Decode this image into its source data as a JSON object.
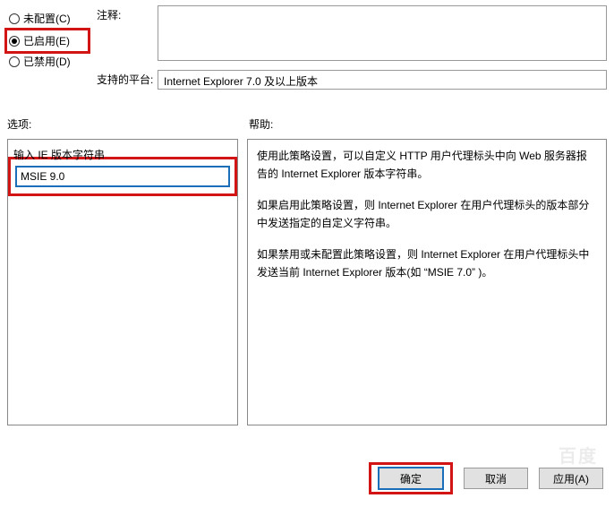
{
  "radios": {
    "unconfigured": "未配置(C)",
    "enabled": "已启用(E)",
    "disabled": "已禁用(D)"
  },
  "labels": {
    "comment": "注释:",
    "platform": "支持的平台:",
    "options": "选项:",
    "help": "帮助:",
    "ie_version": "输入 IE 版本字符串"
  },
  "values": {
    "platform_text": "Internet Explorer 7.0 及以上版本",
    "ie_input": "MSIE 9.0"
  },
  "help_text": {
    "p1": "使用此策略设置，可以自定义 HTTP 用户代理标头中向 Web 服务器报告的 Internet Explorer 版本字符串。",
    "p2": "如果启用此策略设置，则 Internet Explorer 在用户代理标头的版本部分中发送指定的自定义字符串。",
    "p3": "如果禁用或未配置此策略设置，则 Internet Explorer 在用户代理标头中发送当前 Internet Explorer 版本(如 “MSIE 7.0” )。"
  },
  "buttons": {
    "ok": "确定",
    "cancel": "取消",
    "apply": "应用(A)"
  }
}
